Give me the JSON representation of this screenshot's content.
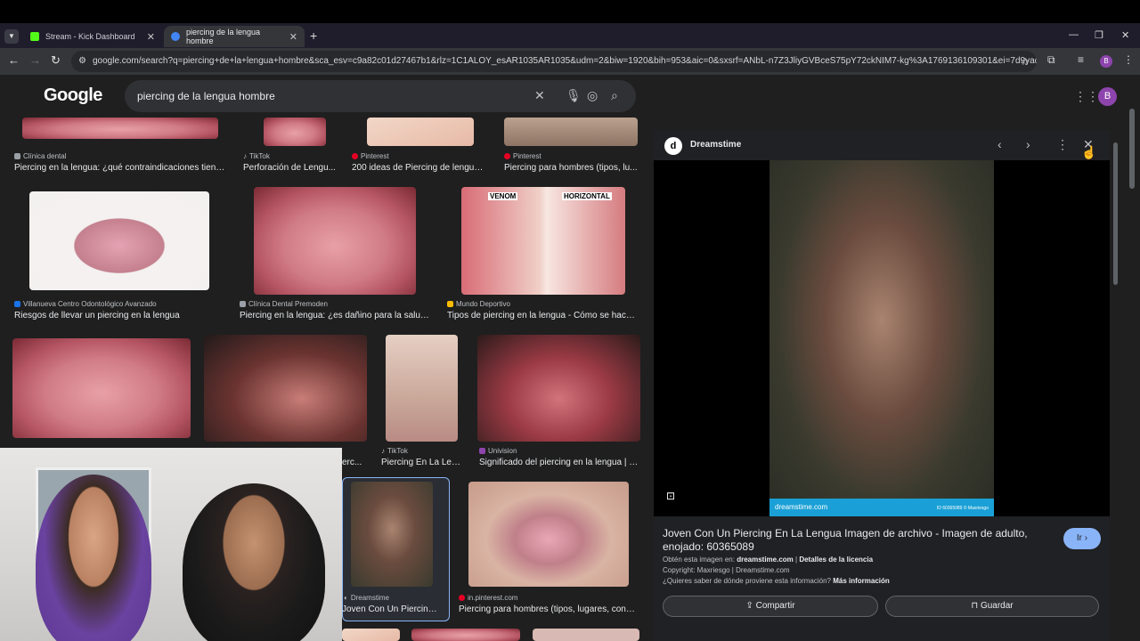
{
  "browser": {
    "tabs": [
      {
        "label": "Stream - Kick Dashboard",
        "active": false,
        "favicon_color": "#53fc18"
      },
      {
        "label": "piercing de la lengua hombre",
        "active": true,
        "favicon_color": "#4285f4"
      }
    ],
    "url": "google.com/search?q=piercing+de+la+lengua+hombre&sca_esv=c9a82c01d27467b1&rlz=1C1ALOY_esAR1035AR1035&udm=2&biw=1920&bih=953&aic=0&sxsrf=ANbL-n7Z3JliyGVBceS75pY72ckNIM7-kg%3A1769136109301&ei=7d9yaceOEvfC5...",
    "profile_initial": "B"
  },
  "search": {
    "logo": "Google",
    "query": "piercing de la lengua hombre",
    "avatar_initial": "B"
  },
  "results": [
    {
      "source": "Clínica dental",
      "title": "Piercing en la lengua: ¿qué contraindicaciones tiene?..."
    },
    {
      "source": "TikTok",
      "title": "Perforación de Lengu..."
    },
    {
      "source": "Pinterest",
      "title": "200 ideas de Piercing de lengua ..."
    },
    {
      "source": "Pinterest",
      "title": "Piercing para hombres (tipos, lu..."
    },
    {
      "source": "Villanueva Centro Odontológico Avanzado",
      "title": "Riesgos de llevar un piercing en la lengua"
    },
    {
      "source": "Clínica Dental Premoden",
      "title": "Piercing en la lengua: ¿es dañino para la salud ..."
    },
    {
      "source": "Mundo Deportivo",
      "title": "Tipos de piercing en la lengua - Cómo se hacen..."
    },
    {
      "source": "TikTok",
      "title": "Piercing En La Len..."
    },
    {
      "source": "Univision",
      "title": "Significado del piercing en la lengua | E..."
    },
    {
      "source": "Dreamstime",
      "title": "Joven Con Un Piercing ..."
    },
    {
      "source": "in.pinterest.com",
      "title": "Piercing para hombres (tipos, lugares, conse..."
    }
  ],
  "overlay_labels": {
    "venom": "VENOM",
    "horizontal": "HORIZONTAL"
  },
  "partial_titles": {
    "cut_off": "erc..."
  },
  "panel": {
    "site_name": "Dreamstime",
    "title": "Joven Con Un Piercing En La Lengua Imagen de archivo - Imagen de adulto, enojado: 60365089",
    "visit_label": "Ir",
    "obtain_prefix": "Obtén esta imagen en:",
    "obtain_site": "dreamstime.com",
    "license_label": "Detalles de la licencia",
    "copyright": "Copyright: Maxriesgo | Dreamstime.com",
    "question": "¿Quieres saber de dónde proviene esta información?",
    "more_info": "Más información",
    "share_label": "Compartir",
    "save_label": "Guardar",
    "image_footer": "dreamstime.com",
    "image_id": "ID 60365089 © Maxriesgo"
  }
}
